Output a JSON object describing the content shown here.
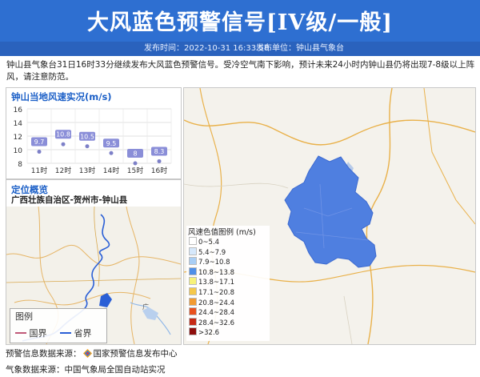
{
  "header": {
    "title": "大风蓝色预警信号[IV级/一般]",
    "publish_time": "发布时间：2022-10-31 16:33:58",
    "publisher": "发布单位：钟山县气象台",
    "bg_color": "#2e6fd1"
  },
  "description": "钟山县气象台31日16时33分继续发布大风蓝色预警信号。受冷空气南下影响，预计未来24小时内钟山县仍将出现7-8级以上阵风，请注意防范。",
  "wind_panel": {
    "title": "钟山当地风速实况(m/s)",
    "chart_data": {
      "type": "line",
      "categories": [
        "11时",
        "12时",
        "13时",
        "14时",
        "15时",
        "16时"
      ],
      "values": [
        9.7,
        10.8,
        10.5,
        9.5,
        8,
        8.3
      ],
      "data_labels": [
        "9.7",
        "10.8",
        "10.5",
        "9.5",
        "8",
        "8.3"
      ],
      "yticks": [
        "8",
        "10",
        "12",
        "14",
        "16"
      ],
      "ylim": [
        8,
        16
      ],
      "grid": true
    }
  },
  "location": {
    "title": "定位概览",
    "region": "广西壮族自治区-贺州市-钟山县",
    "legend_title": "图例",
    "legend_items": [
      {
        "label": "国界",
        "color": "#c05a78"
      },
      {
        "label": "省界",
        "color": "#2a5fd6"
      }
    ],
    "map_label": "广"
  },
  "scale": {
    "title": "风速色值图例 (m/s)",
    "items": [
      {
        "label": "0~5.4",
        "color": "#ffffff"
      },
      {
        "label": "5.4~7.9",
        "color": "#d6e8fb"
      },
      {
        "label": "7.9~10.8",
        "color": "#a9cef5"
      },
      {
        "label": "10.8~13.8",
        "color": "#4f8fe8"
      },
      {
        "label": "13.8~17.1",
        "color": "#f7f27a"
      },
      {
        "label": "17.1~20.8",
        "color": "#f5c84b"
      },
      {
        "label": "20.8~24.4",
        "color": "#f29b32"
      },
      {
        "label": "24.4~28.4",
        "color": "#e8511f"
      },
      {
        "label": "28.4~32.6",
        "color": "#c62a16"
      },
      {
        "label": ">32.6",
        "color": "#8e0e0c"
      }
    ]
  },
  "sources": {
    "warning": "预警信息数据来源：",
    "warning_org": "国家预警信息发布中心",
    "weather": "气象数据来源：中国气象局全国自动站实况"
  }
}
